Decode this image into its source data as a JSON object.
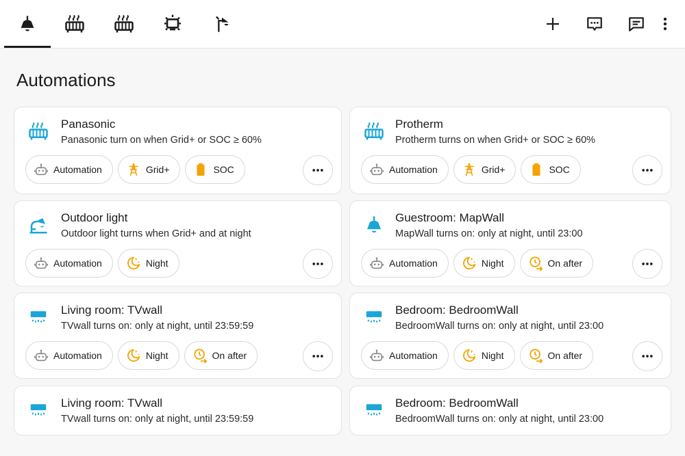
{
  "header": {
    "tabs": [
      {
        "icon": "ceiling-lamp-icon",
        "active": true
      },
      {
        "icon": "radiator-icon",
        "active": false
      },
      {
        "icon": "radiator-icon",
        "active": false
      },
      {
        "icon": "tv-ambilight-icon",
        "active": false
      },
      {
        "icon": "wall-lamp-icon",
        "active": false
      }
    ],
    "actions": [
      "add-icon",
      "chat-dots-icon",
      "message-icon",
      "more-vertical-icon"
    ]
  },
  "page": {
    "title": "Automations"
  },
  "chip_labels": {
    "automation": "Automation",
    "grid": "Grid+",
    "soc": "SOC",
    "night": "Night",
    "on_after": "On after"
  },
  "cards": [
    {
      "icon": "radiator-icon",
      "title": "Panasonic",
      "subtitle": "Panasonic turn on when Grid+ or SOC ≥ 60%"
    },
    {
      "icon": "radiator-icon",
      "title": "Protherm",
      "subtitle": "Protherm turns on when Grid+ or SOC ≥ 60%"
    },
    {
      "icon": "outdoor-lamp-icon",
      "title": "Outdoor light",
      "subtitle": "Outdoor light turns when Grid+ and at night"
    },
    {
      "icon": "ceiling-lamp-icon",
      "title": "Guestroom: MapWall",
      "subtitle": "MapWall turns on: only at night, until 23:00"
    },
    {
      "icon": "wall-light-icon",
      "title": "Living room: TVwall",
      "subtitle": "TVwall turns on: only at night, until 23:59:59"
    },
    {
      "icon": "wall-light-icon",
      "title": "Bedroom: BedroomWall",
      "subtitle": "BedroomWall turns on: only at night, until 23:00"
    },
    {
      "icon": "wall-light-icon",
      "title": "Living room: TVwall",
      "subtitle": "TVwall turns on: only at night, until 23:59:59"
    },
    {
      "icon": "wall-light-icon",
      "title": "Bedroom: BedroomWall",
      "subtitle": "BedroomWall turns on: only at night, until 23:00"
    }
  ],
  "colors": {
    "accent_blue": "#1aa6d8",
    "accent_amber": "#f4a300",
    "text": "#1c1c1c",
    "muted": "#8a8a8a"
  }
}
